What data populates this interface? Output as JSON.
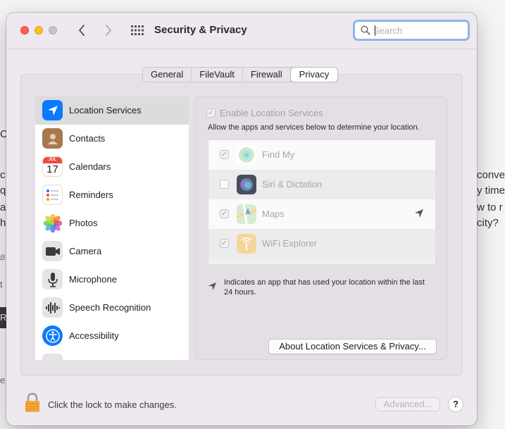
{
  "window": {
    "title": "Security & Privacy",
    "search": {
      "placeholder": "Search",
      "value": ""
    }
  },
  "tabs": [
    {
      "label": "General",
      "active": false
    },
    {
      "label": "FileVault",
      "active": false
    },
    {
      "label": "Firewall",
      "active": false
    },
    {
      "label": "Privacy",
      "active": true
    }
  ],
  "sidebar": {
    "items": [
      {
        "label": "Location Services",
        "icon": "location-arrow-icon",
        "selected": true
      },
      {
        "label": "Contacts",
        "icon": "contacts-icon"
      },
      {
        "label": "Calendars",
        "icon": "calendar-icon",
        "month": "JUL",
        "day": "17"
      },
      {
        "label": "Reminders",
        "icon": "reminders-icon"
      },
      {
        "label": "Photos",
        "icon": "photos-icon"
      },
      {
        "label": "Camera",
        "icon": "camera-icon"
      },
      {
        "label": "Microphone",
        "icon": "microphone-icon"
      },
      {
        "label": "Speech Recognition",
        "icon": "waveform-icon"
      },
      {
        "label": "Accessibility",
        "icon": "accessibility-icon"
      }
    ]
  },
  "location": {
    "enable_label": "Enable Location Services",
    "enable_checked": true,
    "description": "Allow the apps and services below to determine your location.",
    "apps": [
      {
        "name": "Find My",
        "checked": true,
        "icon": "find-my-icon",
        "recent": false
      },
      {
        "name": "Siri & Dictation",
        "checked": false,
        "icon": "siri-icon",
        "recent": false
      },
      {
        "name": "Maps",
        "checked": true,
        "icon": "maps-icon",
        "recent": true
      },
      {
        "name": "WiFi Explorer",
        "checked": true,
        "icon": "wifi-explorer-icon",
        "recent": false
      }
    ],
    "legend": "Indicates an app that has used your location within the last 24 hours.",
    "about_button": "About Location Services & Privacy..."
  },
  "footer": {
    "lock_text": "Click the lock to make changes.",
    "advanced_button": "Advanced...",
    "help_button": "?"
  },
  "background": {
    "fragments": [
      "conver",
      "y time",
      "w to r",
      "city?",
      "C",
      "c",
      "q",
      "a",
      "h",
      "B",
      "t",
      "R",
      "e"
    ]
  },
  "colors": {
    "accent": "#0a7aff",
    "close": "#fe5f57",
    "minimize": "#febc2e",
    "search_ring": "#8fb4ea"
  }
}
